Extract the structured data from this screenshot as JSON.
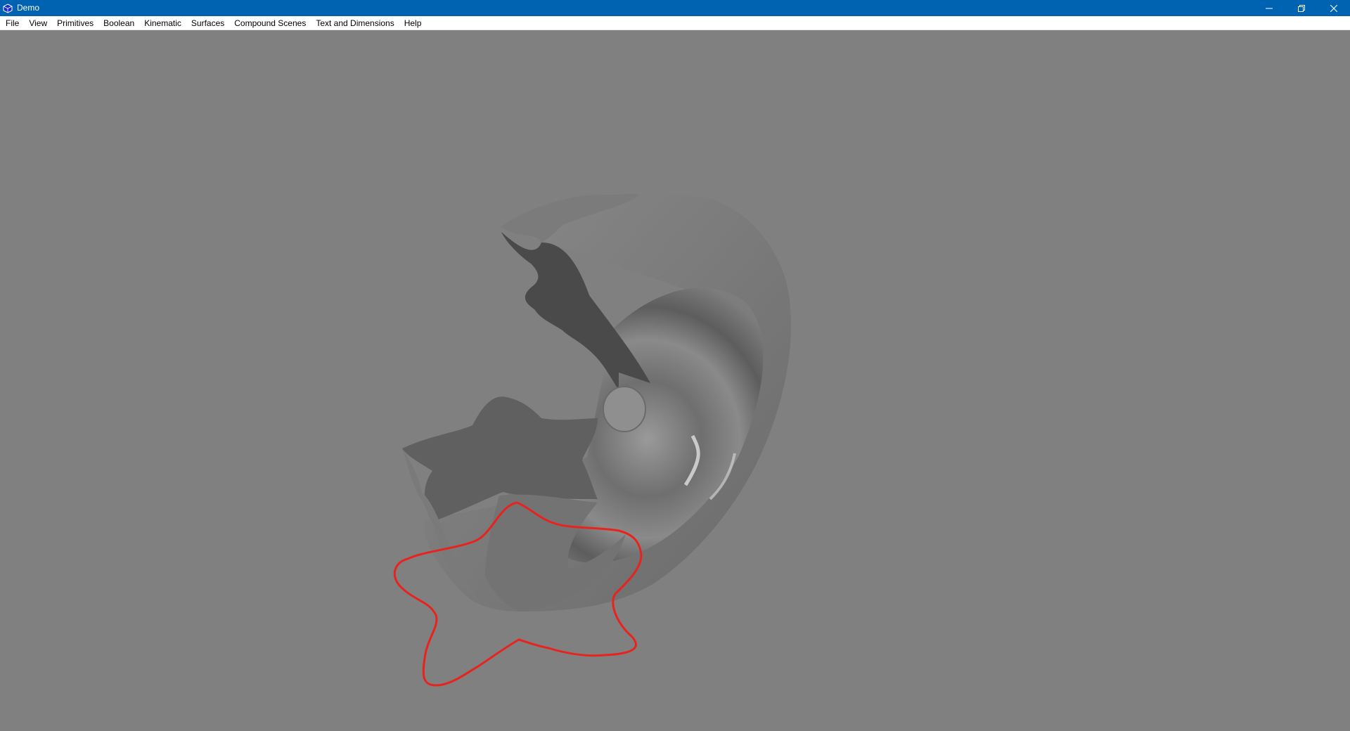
{
  "window": {
    "title": "Demo",
    "icon": "cube-app-icon",
    "controls": [
      "minimize-icon",
      "restore-icon",
      "close-icon"
    ]
  },
  "menu": {
    "items": [
      {
        "label": "File"
      },
      {
        "label": "View"
      },
      {
        "label": "Primitives"
      },
      {
        "label": "Boolean"
      },
      {
        "label": "Kinematic"
      },
      {
        "label": "Surfaces"
      },
      {
        "label": "Compound Scenes"
      },
      {
        "label": "Text and Dimensions"
      },
      {
        "label": "Help"
      }
    ]
  },
  "viewport": {
    "background_color": "#808080",
    "shape_color": "#707070",
    "curve_color": "#e8231e"
  }
}
